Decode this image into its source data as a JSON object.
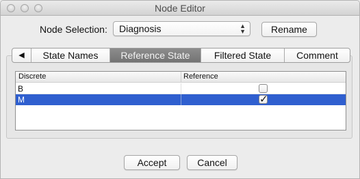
{
  "window": {
    "title": "Node Editor"
  },
  "selection": {
    "label": "Node Selection:",
    "value": "Diagnosis",
    "rename_label": "Rename"
  },
  "tabs": [
    {
      "label": "State Names",
      "active": false
    },
    {
      "label": "Reference State",
      "active": true
    },
    {
      "label": "Filtered State",
      "active": false
    },
    {
      "label": "Comment",
      "active": false
    }
  ],
  "tab_nav_icon": "left-triangle-icon",
  "table": {
    "columns": [
      "Discrete",
      "Reference"
    ],
    "rows": [
      {
        "state": "B",
        "reference": false,
        "selected": false
      },
      {
        "state": "M",
        "reference": true,
        "selected": true
      }
    ]
  },
  "footer": {
    "accept_label": "Accept",
    "cancel_label": "Cancel"
  },
  "colors": {
    "selection": "#2f5fcf",
    "active_tab": "#808080"
  }
}
